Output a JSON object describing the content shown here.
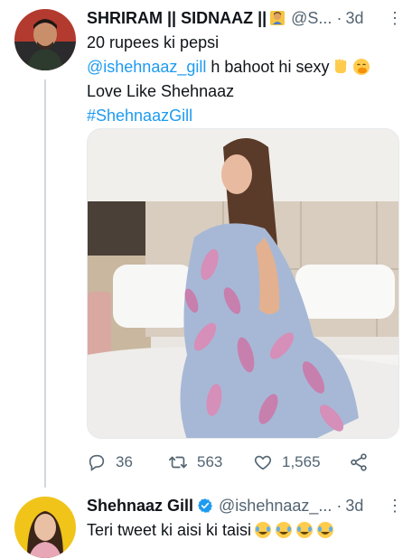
{
  "tweet1": {
    "display_name": "SHRIRAM || SIDNAAZ ||",
    "handle": "@S...",
    "dot": "·",
    "time": "3d",
    "more": "⋮",
    "lines": {
      "line1": "20 rupees ki pepsi",
      "mention": "@ishehnaaz_gill",
      "line2_rest": " h bahoot hi sexy",
      "line3": "Love Like Shehnaaz",
      "hashtag": "#ShehnaazGill"
    },
    "actions": {
      "replies": "36",
      "retweets": "563",
      "likes": "1,565"
    }
  },
  "tweet2": {
    "display_name": "Shehnaaz Gill",
    "handle": "@ishehnaaz_...",
    "dot": "·",
    "time": "3d",
    "more": "⋮",
    "text": "Teri tweet ki aisi ki taisi"
  },
  "colors": {
    "link": "#1d9bf0",
    "secondary_text": "#536471",
    "thread_line": "#cfd9de",
    "verified": "#1d9bf0"
  },
  "icons": [
    "reply-icon",
    "retweet-icon",
    "like-icon",
    "share-icon",
    "verified-badge-icon",
    "more-icon"
  ]
}
